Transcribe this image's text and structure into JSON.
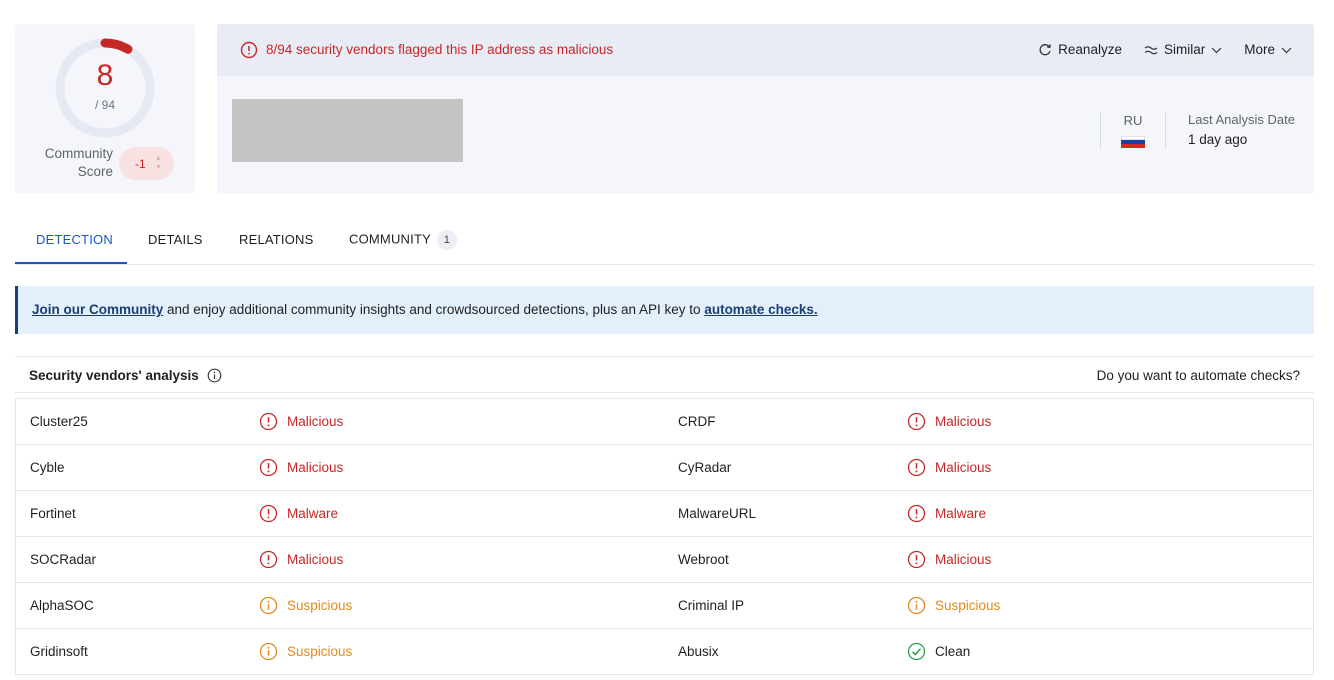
{
  "score": {
    "detected": "8",
    "total": "/ 94",
    "fraction": 0.0851,
    "community_label_1": "Community",
    "community_label_2": "Score",
    "community_value": "-1"
  },
  "alert": {
    "text": "8/94 security vendors flagged this IP address as malicious"
  },
  "actions": {
    "reanalyze": "Reanalyze",
    "similar": "Similar",
    "more": "More"
  },
  "country": {
    "code": "RU",
    "flag_colors": [
      "#ffffff",
      "#1c3faa",
      "#d52b1e"
    ]
  },
  "last_analysis": {
    "label": "Last Analysis Date",
    "value": "1 day ago"
  },
  "tabs": {
    "detection": "DETECTION",
    "details": "DETAILS",
    "relations": "RELATIONS",
    "community": "COMMUNITY",
    "community_count": "1"
  },
  "banner": {
    "link1": "Join our Community",
    "middle": " and enjoy additional community insights and crowdsourced detections, plus an API key to ",
    "link2": "automate checks."
  },
  "vendors": {
    "title": "Security vendors' analysis",
    "automate_link": "Do you want to automate checks?",
    "rows": [
      [
        {
          "name": "Cluster25",
          "result": "Malicious",
          "kind": "malicious"
        },
        {
          "name": "CRDF",
          "result": "Malicious",
          "kind": "malicious"
        }
      ],
      [
        {
          "name": "Cyble",
          "result": "Malicious",
          "kind": "malicious"
        },
        {
          "name": "CyRadar",
          "result": "Malicious",
          "kind": "malicious"
        }
      ],
      [
        {
          "name": "Fortinet",
          "result": "Malware",
          "kind": "malicious"
        },
        {
          "name": "MalwareURL",
          "result": "Malware",
          "kind": "malicious"
        }
      ],
      [
        {
          "name": "SOCRadar",
          "result": "Malicious",
          "kind": "malicious"
        },
        {
          "name": "Webroot",
          "result": "Malicious",
          "kind": "malicious"
        }
      ],
      [
        {
          "name": "AlphaSOC",
          "result": "Suspicious",
          "kind": "suspicious"
        },
        {
          "name": "Criminal IP",
          "result": "Suspicious",
          "kind": "suspicious"
        }
      ],
      [
        {
          "name": "Gridinsoft",
          "result": "Suspicious",
          "kind": "suspicious"
        },
        {
          "name": "Abusix",
          "result": "Clean",
          "kind": "clean"
        }
      ]
    ]
  },
  "colors": {
    "malicious": "#c62828",
    "suspicious": "#e08a1e",
    "clean": "#2e9d4a",
    "accent": "#1a56c4"
  }
}
